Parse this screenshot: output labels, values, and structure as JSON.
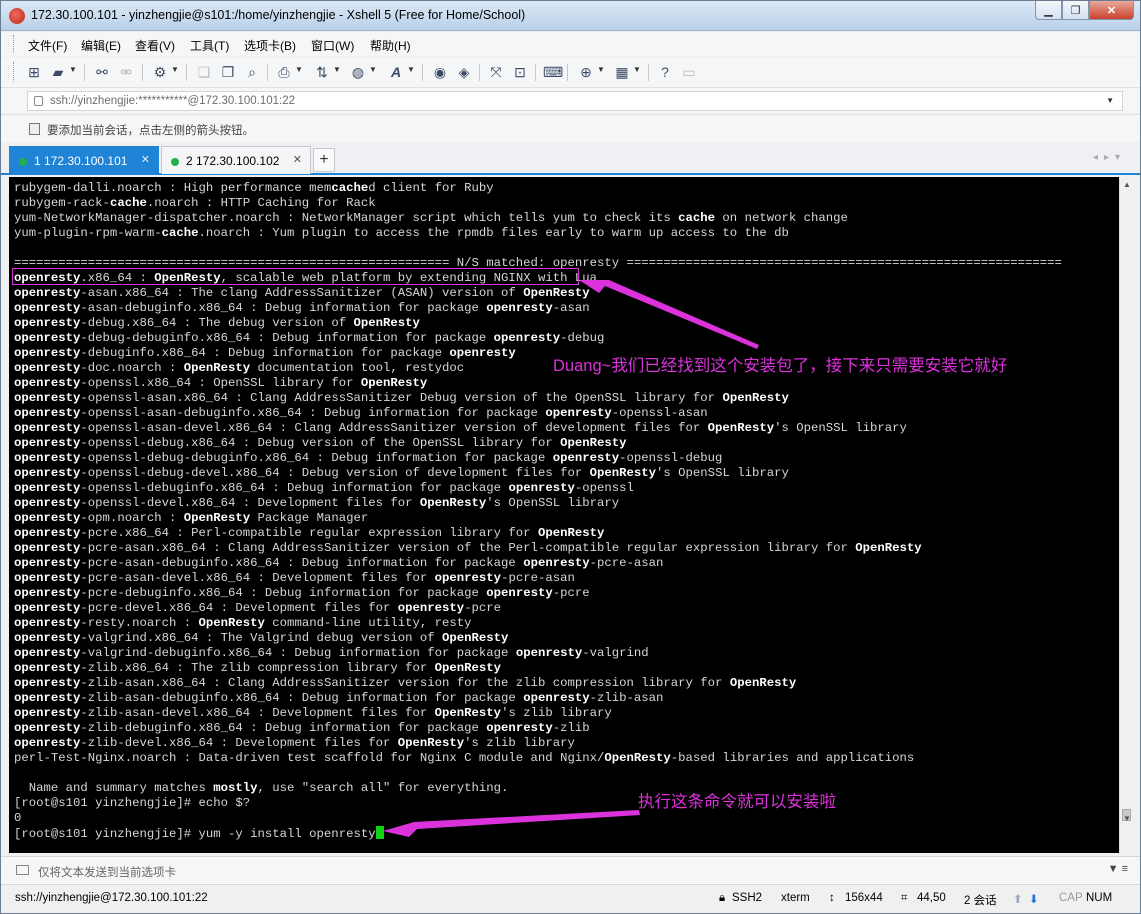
{
  "window": {
    "title": "172.30.100.101 - yinzhengjie@s101:/home/yinzhengjie - Xshell 5 (Free for Home/School)",
    "buttons": {
      "minimize": "▁",
      "restore": "❐",
      "close": "✕"
    }
  },
  "menu": [
    "文件(F)",
    "编辑(E)",
    "查看(V)",
    "工具(T)",
    "选项卡(B)",
    "窗口(W)",
    "帮助(H)"
  ],
  "toolbar": {
    "icons": [
      "new-session-icon",
      "open-folder-icon",
      "reconnect-icon",
      "disconnect-icon",
      "properties-icon",
      "copy-icon",
      "paste-icon",
      "find-icon",
      "print-icon",
      "transfer-icon",
      "globe-icon",
      "font-icon",
      "xftp-icon",
      "xmanager-icon",
      "fullscreen-icon",
      "lock-icon",
      "keyboard-icon",
      "new-tab-icon",
      "layout-icon",
      "help-icon",
      "chat-icon"
    ]
  },
  "address": {
    "value": "ssh://yinzhengjie:***********@172.30.100.101:22"
  },
  "hint": {
    "text": "要添加当前会话，点击左侧的箭头按钮。"
  },
  "tabs": [
    {
      "label": "1 172.30.100.101",
      "active": true,
      "status_color": "#21b04a"
    },
    {
      "label": "2 172.30.100.102",
      "active": false,
      "status_color": "#21b04a"
    }
  ],
  "terminal": {
    "lines": [
      [
        "rubygem-dalli.noarch : High performance mem",
        {
          "b": "cache"
        },
        "d client for Ruby"
      ],
      [
        "rubygem-rack-",
        {
          "b": "cache"
        },
        ".noarch : HTTP Caching for Rack"
      ],
      [
        "yum-NetworkManager-dispatcher.noarch : NetworkManager script which tells yum to check its ",
        {
          "b": "cache"
        },
        " on network change"
      ],
      [
        "yum-plugin-rpm-warm-",
        {
          "b": "cache"
        },
        ".noarch : Yum plugin to access the rpmdb files early to warm up access to the db"
      ],
      [
        ""
      ],
      [
        "=========================================================== N/S matched: openresty ==========================================================="
      ],
      [
        {
          "b": "openresty"
        },
        ".x86_64 : ",
        {
          "b": "OpenResty"
        },
        ", scalable web platform by extending NGINX with Lua"
      ],
      [
        {
          "b": "openresty"
        },
        "-asan.x86_64 : The clang AddressSanitizer (ASAN) version of ",
        {
          "b": "OpenResty"
        }
      ],
      [
        {
          "b": "openresty"
        },
        "-asan-debuginfo.x86_64 : Debug information for package ",
        {
          "b": "openresty"
        },
        "-asan"
      ],
      [
        {
          "b": "openresty"
        },
        "-debug.x86_64 : The debug version of ",
        {
          "b": "OpenResty"
        }
      ],
      [
        {
          "b": "openresty"
        },
        "-debug-debuginfo.x86_64 : Debug information for package ",
        {
          "b": "openresty"
        },
        "-debug"
      ],
      [
        {
          "b": "openresty"
        },
        "-debuginfo.x86_64 : Debug information for package ",
        {
          "b": "openresty"
        }
      ],
      [
        {
          "b": "openresty"
        },
        "-doc.noarch : ",
        {
          "b": "OpenResty"
        },
        " documentation tool, restydoc"
      ],
      [
        {
          "b": "openresty"
        },
        "-openssl.x86_64 : OpenSSL library for ",
        {
          "b": "OpenResty"
        }
      ],
      [
        {
          "b": "openresty"
        },
        "-openssl-asan.x86_64 : Clang AddressSanitizer Debug version of the OpenSSL library for ",
        {
          "b": "OpenResty"
        }
      ],
      [
        {
          "b": "openresty"
        },
        "-openssl-asan-debuginfo.x86_64 : Debug information for package ",
        {
          "b": "openresty"
        },
        "-openssl-asan"
      ],
      [
        {
          "b": "openresty"
        },
        "-openssl-asan-devel.x86_64 : Clang AddressSanitizer version of development files for ",
        {
          "b": "OpenResty"
        },
        "'s OpenSSL library"
      ],
      [
        {
          "b": "openresty"
        },
        "-openssl-debug.x86_64 : Debug version of the OpenSSL library for ",
        {
          "b": "OpenResty"
        }
      ],
      [
        {
          "b": "openresty"
        },
        "-openssl-debug-debuginfo.x86_64 : Debug information for package ",
        {
          "b": "openresty"
        },
        "-openssl-debug"
      ],
      [
        {
          "b": "openresty"
        },
        "-openssl-debug-devel.x86_64 : Debug version of development files for ",
        {
          "b": "OpenResty"
        },
        "'s OpenSSL library"
      ],
      [
        {
          "b": "openresty"
        },
        "-openssl-debuginfo.x86_64 : Debug information for package ",
        {
          "b": "openresty"
        },
        "-openssl"
      ],
      [
        {
          "b": "openresty"
        },
        "-openssl-devel.x86_64 : Development files for ",
        {
          "b": "OpenResty"
        },
        "'s OpenSSL library"
      ],
      [
        {
          "b": "openresty"
        },
        "-opm.noarch : ",
        {
          "b": "OpenResty"
        },
        " Package Manager"
      ],
      [
        {
          "b": "openresty"
        },
        "-pcre.x86_64 : Perl-compatible regular expression library for ",
        {
          "b": "OpenResty"
        }
      ],
      [
        {
          "b": "openresty"
        },
        "-pcre-asan.x86_64 : Clang AddressSanitizer version of the Perl-compatible regular expression library for ",
        {
          "b": "OpenResty"
        }
      ],
      [
        {
          "b": "openresty"
        },
        "-pcre-asan-debuginfo.x86_64 : Debug information for package ",
        {
          "b": "openresty"
        },
        "-pcre-asan"
      ],
      [
        {
          "b": "openresty"
        },
        "-pcre-asan-devel.x86_64 : Development files for ",
        {
          "b": "openresty"
        },
        "-pcre-asan"
      ],
      [
        {
          "b": "openresty"
        },
        "-pcre-debuginfo.x86_64 : Debug information for package ",
        {
          "b": "openresty"
        },
        "-pcre"
      ],
      [
        {
          "b": "openresty"
        },
        "-pcre-devel.x86_64 : Development files for ",
        {
          "b": "openresty"
        },
        "-pcre"
      ],
      [
        {
          "b": "openresty"
        },
        "-resty.noarch : ",
        {
          "b": "OpenResty"
        },
        " command-line utility, resty"
      ],
      [
        {
          "b": "openresty"
        },
        "-valgrind.x86_64 : The Valgrind debug version of ",
        {
          "b": "OpenResty"
        }
      ],
      [
        {
          "b": "openresty"
        },
        "-valgrind-debuginfo.x86_64 : Debug information for package ",
        {
          "b": "openresty"
        },
        "-valgrind"
      ],
      [
        {
          "b": "openresty"
        },
        "-zlib.x86_64 : The zlib compression library for ",
        {
          "b": "OpenResty"
        }
      ],
      [
        {
          "b": "openresty"
        },
        "-zlib-asan.x86_64 : Clang AddressSanitizer version for the zlib compression library for ",
        {
          "b": "OpenResty"
        }
      ],
      [
        {
          "b": "openresty"
        },
        "-zlib-asan-debuginfo.x86_64 : Debug information for package ",
        {
          "b": "openresty"
        },
        "-zlib-asan"
      ],
      [
        {
          "b": "openresty"
        },
        "-zlib-asan-devel.x86_64 : Development files for ",
        {
          "b": "OpenResty"
        },
        "'s zlib library"
      ],
      [
        {
          "b": "openresty"
        },
        "-zlib-debuginfo.x86_64 : Debug information for package ",
        {
          "b": "openresty"
        },
        "-zlib"
      ],
      [
        {
          "b": "openresty"
        },
        "-zlib-devel.x86_64 : Development files for ",
        {
          "b": "OpenResty"
        },
        "'s zlib library"
      ],
      [
        "perl-Test-Nginx.noarch : Data-driven test scaffold for Nginx C module and Nginx/",
        {
          "b": "OpenResty"
        },
        "-based libraries and applications"
      ],
      [
        ""
      ],
      [
        "  Name and summary matches ",
        {
          "b": "mostly"
        },
        ", use \"search all\" for everything."
      ],
      [
        "[root@s101 yinzhengjie]# echo $?"
      ],
      [
        "0"
      ],
      [
        "[root@s101 yinzhengjie]# yum -y install openresty",
        {
          "cursor": true
        }
      ]
    ],
    "annotations": {
      "found": "Duang~我们已经找到这个安装包了，接下来只需要安装它就好",
      "install": "执行这条命令就可以安装啦"
    },
    "annotation_color": "#dc32dc"
  },
  "send_bar": {
    "text": "仅将文本发送到当前选项卡"
  },
  "status": {
    "connection": "ssh://yinzhengjie@172.30.100.101:22",
    "protocol": "SSH2",
    "term": "xterm",
    "size": "156x44",
    "cursor_pos": "44,50",
    "sessions": "2 会话",
    "caps": "CAP",
    "num": "NUM"
  }
}
